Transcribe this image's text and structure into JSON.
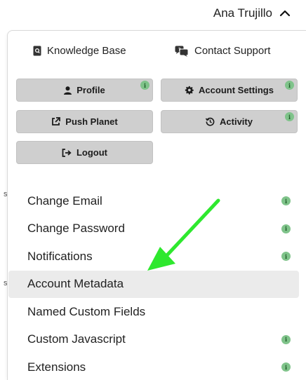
{
  "header": {
    "user_name": "Ana Trujillo"
  },
  "top_links": {
    "knowledge_base": "Knowledge Base",
    "contact_support": "Contact Support"
  },
  "buttons": {
    "profile": "Profile",
    "account_settings": "Account Settings",
    "push_planet": "Push Planet",
    "activity": "Activity",
    "logout": "Logout"
  },
  "badge_glyph": "i",
  "menu": {
    "items": [
      {
        "label": "Change Email",
        "badge": true
      },
      {
        "label": "Change Password",
        "badge": true
      },
      {
        "label": "Notifications",
        "badge": true
      },
      {
        "label": "Account Metadata",
        "badge": false,
        "active": true
      },
      {
        "label": "Named Custom Fields",
        "badge": false
      },
      {
        "label": "Custom Javascript",
        "badge": true
      },
      {
        "label": "Extensions",
        "badge": true
      }
    ]
  },
  "edge_glyphs": [
    "s",
    "s"
  ],
  "colors": {
    "button_bg": "#cfcfcf",
    "badge_bg": "#7fc38a",
    "active_row_bg": "#ebebeb",
    "annotation_arrow": "#2ee82e"
  },
  "icons": {
    "user_toggle": "chevron-up-icon",
    "knowledge_base": "book-search-icon",
    "contact_support": "chat-bubbles-icon",
    "profile": "user-icon",
    "account_settings": "gear-icon",
    "push_planet": "external-link-icon",
    "activity": "history-icon",
    "logout": "logout-icon",
    "annotation": "arrow-annotation"
  }
}
